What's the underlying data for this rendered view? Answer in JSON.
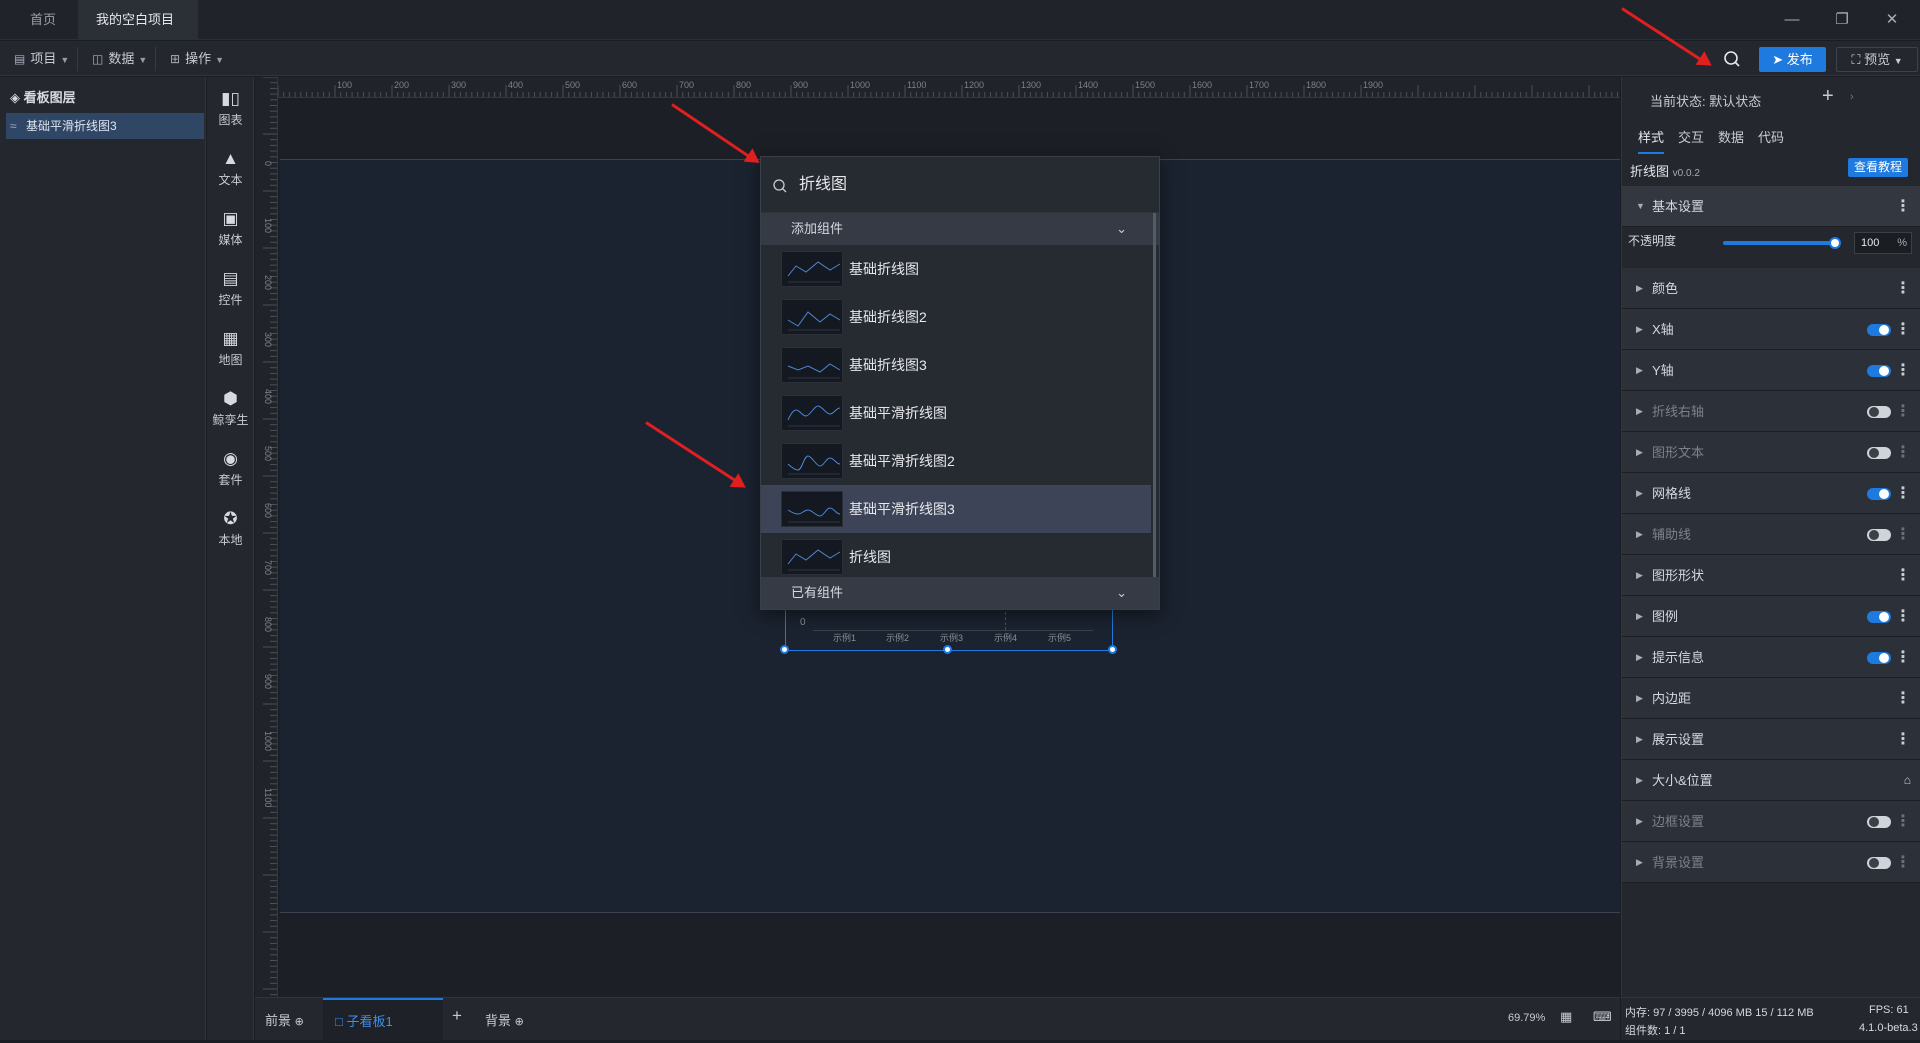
{
  "titlebar": {
    "tabs": [
      {
        "label": "首页"
      },
      {
        "label": "我的空白项目"
      }
    ]
  },
  "menubar": {
    "items": [
      {
        "label": "项目"
      },
      {
        "label": "数据"
      },
      {
        "label": "操作"
      }
    ],
    "publish_label": "发布",
    "preview_label": "预览"
  },
  "layers": {
    "title": "看板图层",
    "items": [
      {
        "label": "基础平滑折线图3"
      }
    ]
  },
  "sidebar": {
    "items": [
      {
        "label": "图表",
        "icon": "bar-chart-icon"
      },
      {
        "label": "文本",
        "icon": "text-icon"
      },
      {
        "label": "媒体",
        "icon": "media-icon"
      },
      {
        "label": "控件",
        "icon": "widget-icon"
      },
      {
        "label": "地图",
        "icon": "map-icon"
      },
      {
        "label": "鲸孪生",
        "icon": "cube-icon"
      },
      {
        "label": "套件",
        "icon": "shirt-icon"
      },
      {
        "label": "本地",
        "icon": "puzzle-icon"
      }
    ]
  },
  "ruler": {
    "top_ticks": [
      "100",
      "200",
      "300",
      "400",
      "500",
      "600",
      "700",
      "800",
      "900",
      "1000",
      "1100",
      "1200",
      "1300",
      "1400",
      "1500",
      "1600",
      "1700",
      "1800",
      "1900"
    ],
    "left_ticks": [
      "0",
      "100",
      "200",
      "300",
      "400",
      "500",
      "600",
      "700",
      "800",
      "900",
      "1000",
      "1100"
    ]
  },
  "chart_preview": {
    "zero": "0",
    "categories": [
      "示例1",
      "示例2",
      "示例3",
      "示例4",
      "示例5"
    ]
  },
  "popup": {
    "search_value": "折线图",
    "section_add": "添加组件",
    "items": [
      {
        "label": "基础折线图"
      },
      {
        "label": "基础折线图2"
      },
      {
        "label": "基础折线图3"
      },
      {
        "label": "基础平滑折线图"
      },
      {
        "label": "基础平滑折线图2"
      },
      {
        "label": "基础平滑折线图3"
      },
      {
        "label": "折线图"
      }
    ],
    "section_existing": "已有组件"
  },
  "bottom": {
    "tabs": [
      {
        "label": "前景"
      },
      {
        "label": "子看板1"
      },
      {
        "label": "背景"
      }
    ],
    "zoom": "69.79%"
  },
  "props": {
    "state_label": "当前状态:",
    "state_value": "默认状态",
    "tabs": [
      {
        "label": "样式"
      },
      {
        "label": "交互"
      },
      {
        "label": "数据"
      },
      {
        "label": "代码"
      }
    ],
    "component_name": "折线图",
    "component_version": "v0.0.2",
    "tutorial_label": "查看教程",
    "basic_section": "基本设置",
    "opacity_label": "不透明度",
    "opacity_value": "100",
    "opacity_unit": "%",
    "rows": [
      {
        "label": "颜色",
        "toggle": "none",
        "enabled": true
      },
      {
        "label": "X轴",
        "toggle": "on",
        "enabled": true
      },
      {
        "label": "Y轴",
        "toggle": "on",
        "enabled": true
      },
      {
        "label": "折线右轴",
        "toggle": "off",
        "enabled": false
      },
      {
        "label": "图形文本",
        "toggle": "off",
        "enabled": false
      },
      {
        "label": "网格线",
        "toggle": "on",
        "enabled": true
      },
      {
        "label": "辅助线",
        "toggle": "off",
        "enabled": false
      },
      {
        "label": "图形形状",
        "toggle": "none",
        "enabled": true
      },
      {
        "label": "图例",
        "toggle": "on",
        "enabled": true
      },
      {
        "label": "提示信息",
        "toggle": "on",
        "enabled": true
      },
      {
        "label": "内边距",
        "toggle": "none",
        "enabled": true
      },
      {
        "label": "展示设置",
        "toggle": "none",
        "enabled": true
      },
      {
        "label": "大小&位置",
        "toggle": "lock",
        "enabled": true
      },
      {
        "label": "边框设置",
        "toggle": "off",
        "enabled": false
      },
      {
        "label": "背景设置",
        "toggle": "off",
        "enabled": false
      }
    ]
  },
  "status": {
    "memory": "内存: 97 / 3995 / 4096 MB 15 / 112 MB",
    "fps": "FPS: 61",
    "components": "组件数: 1 / 1",
    "version": "4.1.0-beta.3"
  },
  "colors": {
    "accent": "#1f7ae0",
    "annotation_arrow": "#e02020",
    "unsaved_dot": "#f0b429"
  }
}
